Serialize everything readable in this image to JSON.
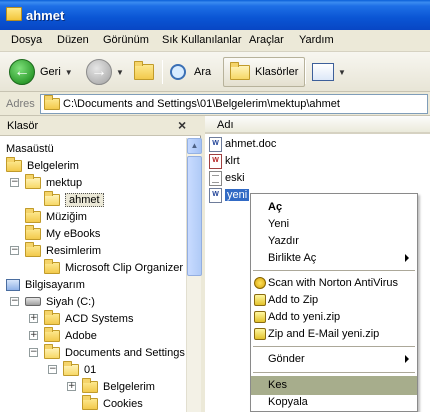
{
  "window": {
    "title": "ahmet"
  },
  "menu": [
    "Dosya",
    "Düzen",
    "Görünüm",
    "Sık Kullanılanlar",
    "Araçlar",
    "Yardım"
  ],
  "toolbar": {
    "back_label": "Geri",
    "search_label": "Ara",
    "folders_label": "Klasörler"
  },
  "address": {
    "label": "Adres",
    "path": "C:\\Documents and Settings\\01\\Belgelerim\\mektup\\ahmet"
  },
  "folder_pane": {
    "title": "Klasör",
    "items": [
      "Masaüstü",
      "Belgelerim",
      "mektup",
      "ahmet",
      "Müziğim",
      "My eBooks",
      "Resimlerim",
      "Microsoft Clip Organizer",
      "Bilgisayarım",
      "Siyah (C:)",
      "ACD Systems",
      "Adobe",
      "Documents and Settings",
      "01",
      "Belgelerim",
      "Cookies"
    ]
  },
  "file_pane": {
    "column_name": "Adı",
    "files": [
      "ahmet.doc",
      "klrt",
      "eski",
      "yeni"
    ]
  },
  "context_menu": {
    "items": [
      "Aç",
      "Yeni",
      "Yazdır",
      "Birlikte Aç",
      "Scan with Norton AntiVirus",
      "Add to Zip",
      "Add to yeni.zip",
      "Zip and E-Mail yeni.zip",
      "Gönder",
      "Kes",
      "Kopyala"
    ],
    "highlighted": "Kes"
  }
}
